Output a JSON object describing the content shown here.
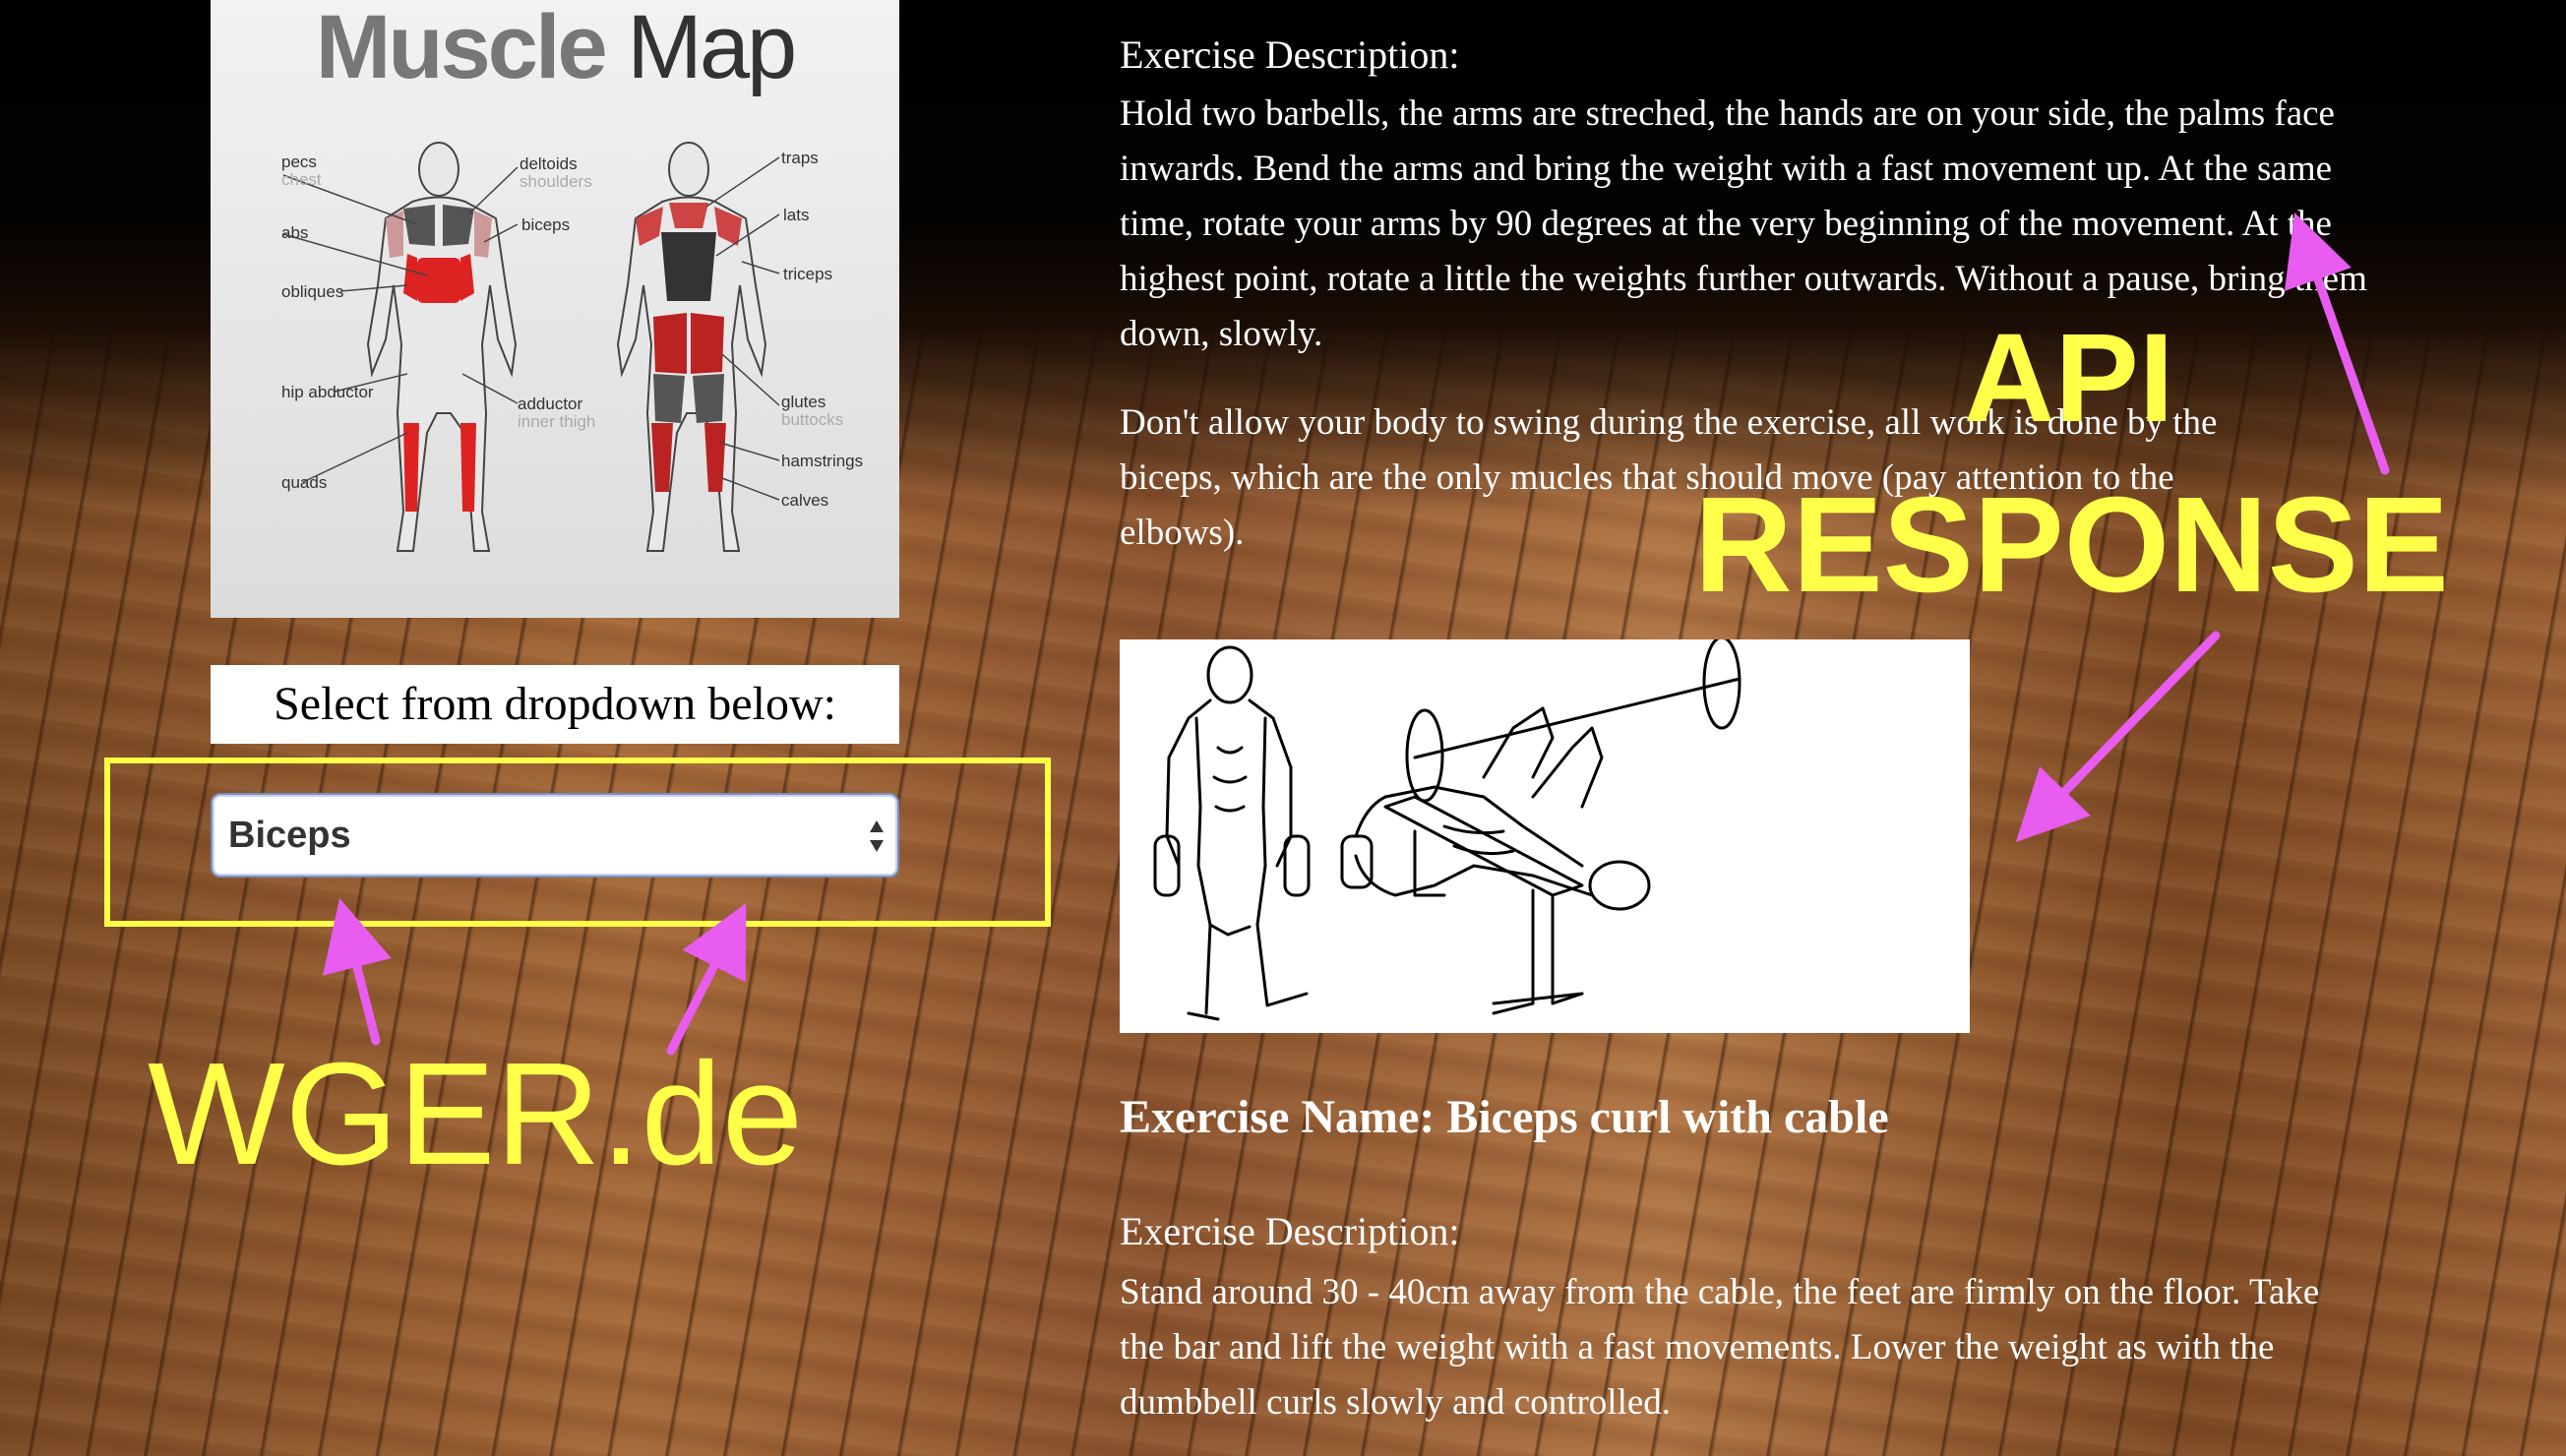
{
  "muscle_map": {
    "title_bold": "Muscle",
    "title_light": "Map",
    "labels_front": {
      "pecs": "pecs",
      "pecs_sub": "chest",
      "abs": "abs",
      "obliques": "obliques",
      "hip_abductor": "hip abductor",
      "quads": "quads",
      "deltoids": "deltoids",
      "deltoids_sub": "shoulders",
      "biceps": "biceps",
      "adductor": "adductor",
      "adductor_sub": "inner thigh"
    },
    "labels_back": {
      "traps": "traps",
      "lats": "lats",
      "triceps": "triceps",
      "glutes": "glutes",
      "glutes_sub": "buttocks",
      "hamstrings": "hamstrings",
      "calves": "calves"
    }
  },
  "select": {
    "label": "Select from dropdown below:",
    "value": "Biceps"
  },
  "exercise1": {
    "desc_heading": "Exercise Description:",
    "para1": "Hold two barbells, the arms are streched, the hands are on your side, the palms face inwards. Bend the arms and bring the weight with a fast movement up. At the same time, rotate your arms by 90 degrees at the very beginning of the movement. At the highest point, rotate a little the weights further outwards. Without a pause, bring them down, slowly.",
    "para2": "Don't allow your body to swing during the exercise, all work is done by the biceps, which are the only mucles that should move (pay attention to the elbows)."
  },
  "exercise2": {
    "name": "Exercise Name: Biceps curl with cable",
    "desc_heading": "Exercise Description:",
    "para1": "Stand around 30 - 40cm away from the cable, the feet are firmly on the floor. Take the bar and lift the weight with a fast movements. Lower the weight as with the dumbbell curls slowly and controlled."
  },
  "annotations": {
    "api": "API",
    "response": "RESPONSE",
    "wger": "WGER.de",
    "yellow": "#ffff4a",
    "magenta": "#e85cf0"
  }
}
